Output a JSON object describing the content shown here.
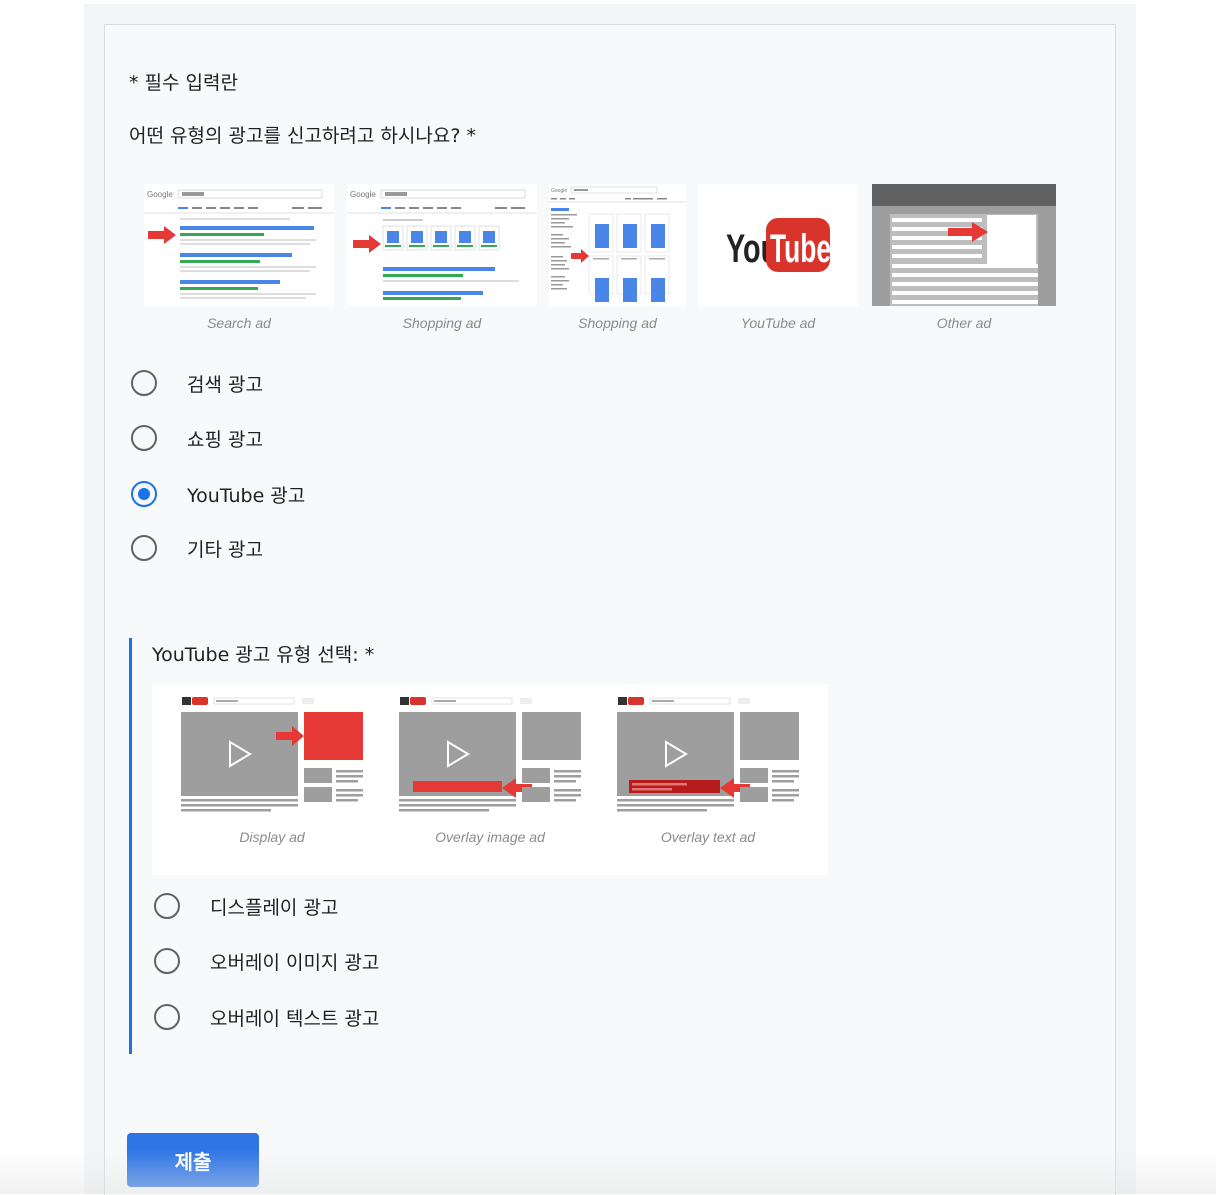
{
  "form": {
    "required_note": "* 필수 입력란",
    "question1": "어떤 유형의 광고를 신고하려고 하시나요? *",
    "ad_types": [
      {
        "caption": "Search ad"
      },
      {
        "caption": "Shopping ad"
      },
      {
        "caption": "Shopping ad"
      },
      {
        "caption": "YouTube ad"
      },
      {
        "caption": "Other ad"
      }
    ],
    "google_logo": "Google",
    "youtube_logo": {
      "you": "You",
      "tube": "Tube"
    },
    "options1": [
      {
        "label": "검색 광고",
        "selected": false
      },
      {
        "label": "쇼핑 광고",
        "selected": false
      },
      {
        "label": "YouTube 광고",
        "selected": true
      },
      {
        "label": "기타 광고",
        "selected": false
      }
    ],
    "question2": "YouTube 광고 유형 선택: *",
    "yt_ad_types": [
      {
        "caption": "Display ad"
      },
      {
        "caption": "Overlay image ad"
      },
      {
        "caption": "Overlay text ad"
      }
    ],
    "options2": [
      {
        "label": "디스플레이 광고",
        "selected": false
      },
      {
        "label": "오버레이 이미지 광고",
        "selected": false
      },
      {
        "label": "오버레이 텍스트 광고",
        "selected": false
      }
    ],
    "submit_label": "제출"
  },
  "colors": {
    "accent": "#1a73e8",
    "submit": "#2f75e6",
    "arrow_red": "#e53935",
    "result_blue": "#4a86e8",
    "result_green": "#34a853",
    "youtube_red": "#d9342b"
  }
}
